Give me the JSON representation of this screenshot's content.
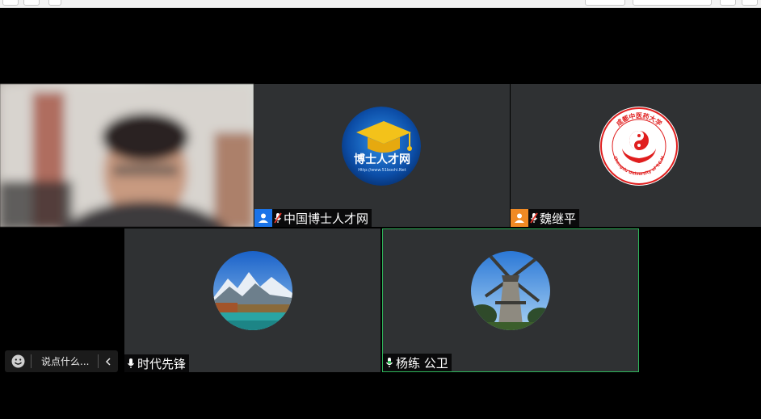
{
  "participants": [
    {
      "name": "中国博士人才网",
      "role": "host",
      "muted": true
    },
    {
      "name": "魏继平",
      "role": "co-host",
      "muted": true
    },
    {
      "name": "时代先锋",
      "muted": false
    },
    {
      "name": "杨练 公卫",
      "muted": false,
      "active_speaker": true
    }
  ],
  "logos": {
    "bosu_title": "博士人才网",
    "bosu_url": "Http://www.51boshi.Net",
    "chengdu_arc": "成都中医药大学",
    "chengdu_en": "Chengdu University of T.C.M"
  },
  "chat": {
    "placeholder": "说点什么..."
  },
  "colors": {
    "tile_bg": "#2f3133",
    "active_border": "#2eb45a",
    "host_badge": "#1a73e8",
    "cohost_badge": "#f08a24"
  }
}
